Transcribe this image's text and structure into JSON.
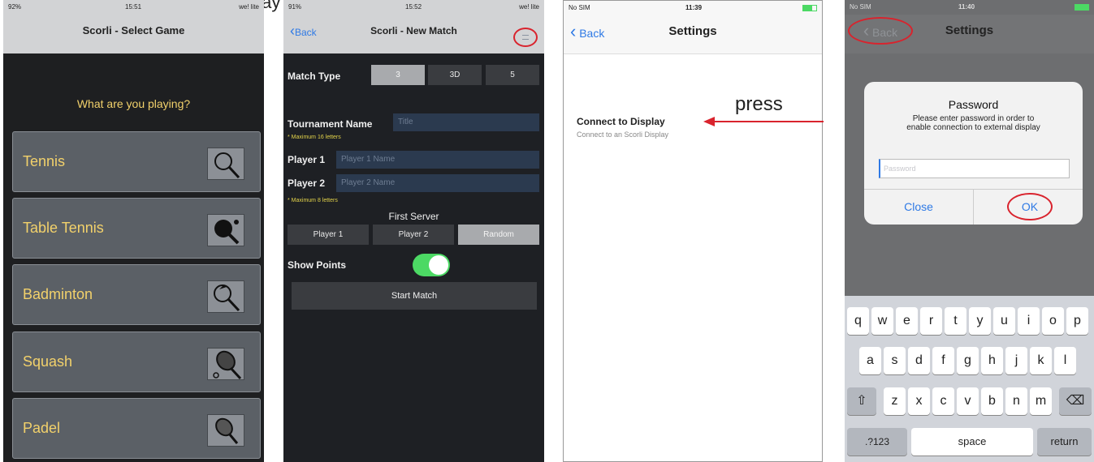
{
  "header_text": "play",
  "phone1": {
    "status": {
      "battery": "92%",
      "time": "15:51",
      "network": "we! lite"
    },
    "title": "Scorli - Select Game",
    "prompt": "What are you playing?",
    "games": [
      {
        "label": "Tennis",
        "icon": "tennis-racket-icon"
      },
      {
        "label": "Table Tennis",
        "icon": "ping-pong-paddle-icon"
      },
      {
        "label": "Badminton",
        "icon": "badminton-racket-icon"
      },
      {
        "label": "Squash",
        "icon": "squash-racket-icon"
      },
      {
        "label": "Padel",
        "icon": "padel-racket-icon"
      }
    ]
  },
  "phone2": {
    "status": {
      "battery": "91%",
      "time": "15:52",
      "network": "we! lite"
    },
    "back": "Back",
    "title": "Scorli - New Match",
    "menu_icon": "menu-icon",
    "match_type_label": "Match Type",
    "match_types": [
      "3",
      "3D",
      "5"
    ],
    "tournament_label": "Tournament Name",
    "tournament_placeholder": "Title",
    "hint_16": "* Maximum 16 letters",
    "player1_label": "Player 1",
    "player1_placeholder": "Player 1 Name",
    "player2_label": "Player 2",
    "player2_placeholder": "Player 2 Name",
    "hint_8": "* Maximum 8 letters",
    "first_server_label": "First Server",
    "servers": [
      "Player 1",
      "Player 2",
      "Random"
    ],
    "show_points_label": "Show Points",
    "start_label": "Start Match"
  },
  "phone3": {
    "status": {
      "carrier": "No SIM",
      "time": "11:39"
    },
    "back": "Back",
    "title": "Settings",
    "item_title": "Connect to Display",
    "item_sub": "Connect to an Scorli Display"
  },
  "annotation": {
    "press": "press",
    "accent": "#d9232d"
  },
  "phone4": {
    "status": {
      "carrier": "No SIM",
      "time": "11:40"
    },
    "back": "Back",
    "title": "Settings",
    "dialog_title": "Password",
    "dialog_msg1": "Please enter password in order to",
    "dialog_msg2": "enable connection to external display",
    "placeholder": "Password",
    "close": "Close",
    "ok": "OK",
    "row1": [
      "q",
      "w",
      "e",
      "r",
      "t",
      "y",
      "u",
      "i",
      "o",
      "p"
    ],
    "row2": [
      "a",
      "s",
      "d",
      "f",
      "g",
      "h",
      "j",
      "k",
      "l"
    ],
    "row3": [
      "z",
      "x",
      "c",
      "v",
      "b",
      "n",
      "m"
    ],
    "numbers_key": ".?123",
    "space_key": "space",
    "return_key": "return"
  }
}
